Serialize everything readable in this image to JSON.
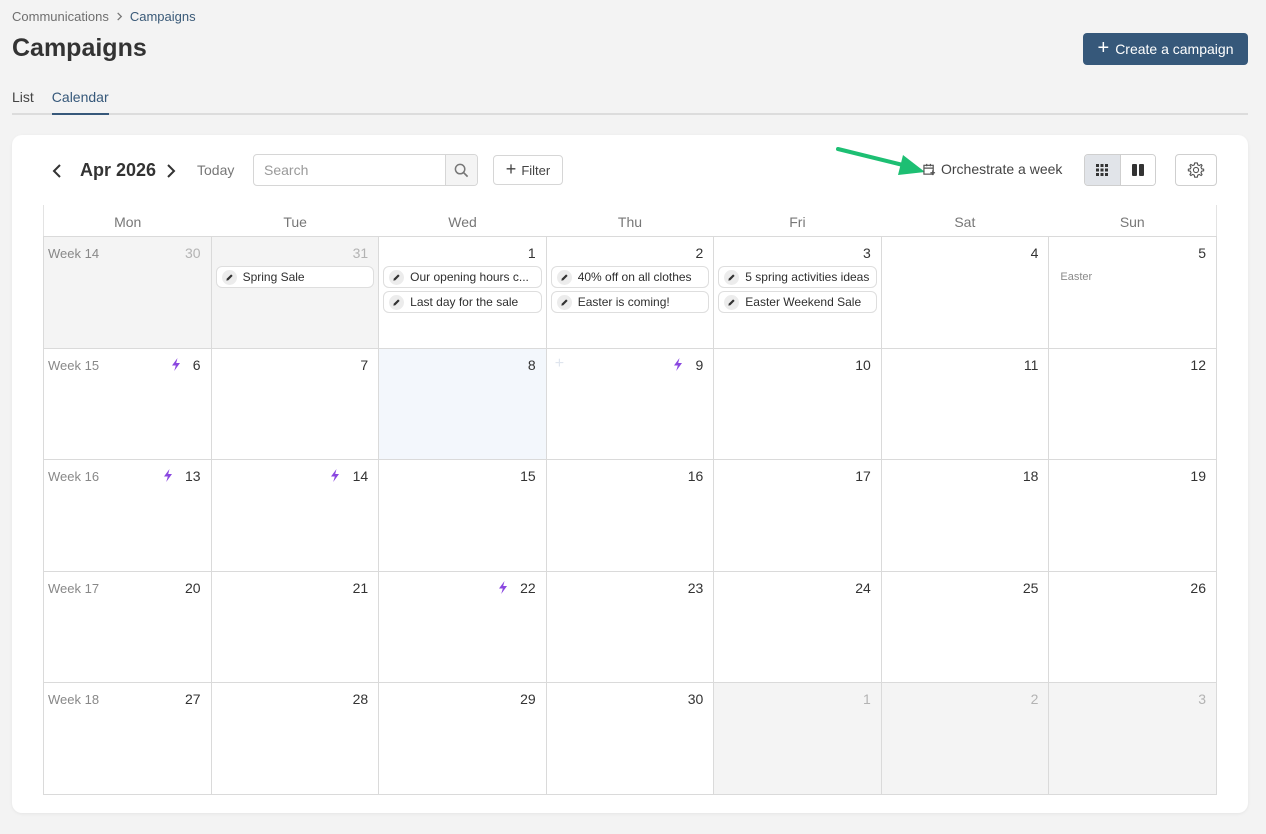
{
  "breadcrumb": {
    "parent": "Communications",
    "current": "Campaigns"
  },
  "page": {
    "title": "Campaigns",
    "create_label": "Create a campaign"
  },
  "tabs": [
    {
      "label": "List"
    },
    {
      "label": "Calendar"
    }
  ],
  "toolbar": {
    "month": "Apr 2026",
    "today_label": "Today",
    "search_placeholder": "Search",
    "filter_label": "Filter",
    "orchestrate_label": "Orchestrate a week"
  },
  "colors": {
    "accent": "#36587a",
    "bolt": "#8a47e0",
    "annotation_arrow": "#1dbf73"
  },
  "calendar": {
    "weekdays": [
      "Mon",
      "Tue",
      "Wed",
      "Thu",
      "Fri",
      "Sat",
      "Sun"
    ],
    "weeks": [
      {
        "label": "Week 14",
        "days": [
          {
            "day": "30",
            "muted": true
          },
          {
            "day": "31",
            "muted": true,
            "events": [
              "Spring Sale"
            ]
          },
          {
            "day": "1",
            "events": [
              "Our opening hours c...",
              "Last day for the sale"
            ]
          },
          {
            "day": "2",
            "events": [
              "40% off on all clothes",
              "Easter is coming!"
            ]
          },
          {
            "day": "3",
            "events": [
              "5 spring activities ideas",
              "Easter Weekend Sale"
            ]
          },
          {
            "day": "4"
          },
          {
            "day": "5",
            "holiday": "Easter"
          }
        ]
      },
      {
        "label": "Week 15",
        "days": [
          {
            "day": "6",
            "bolt": true
          },
          {
            "day": "7"
          },
          {
            "day": "8",
            "today": true
          },
          {
            "day": "9",
            "bolt": true,
            "hover_plus": true
          },
          {
            "day": "10"
          },
          {
            "day": "11"
          },
          {
            "day": "12"
          }
        ]
      },
      {
        "label": "Week 16",
        "days": [
          {
            "day": "13",
            "bolt": true
          },
          {
            "day": "14",
            "bolt": true
          },
          {
            "day": "15"
          },
          {
            "day": "16"
          },
          {
            "day": "17"
          },
          {
            "day": "18"
          },
          {
            "day": "19"
          }
        ]
      },
      {
        "label": "Week 17",
        "days": [
          {
            "day": "20"
          },
          {
            "day": "21"
          },
          {
            "day": "22",
            "bolt": true
          },
          {
            "day": "23"
          },
          {
            "day": "24"
          },
          {
            "day": "25"
          },
          {
            "day": "26"
          }
        ]
      },
      {
        "label": "Week 18",
        "days": [
          {
            "day": "27"
          },
          {
            "day": "28"
          },
          {
            "day": "29"
          },
          {
            "day": "30"
          },
          {
            "day": "1",
            "muted": true
          },
          {
            "day": "2",
            "muted": true
          },
          {
            "day": "3",
            "muted": true
          }
        ]
      }
    ]
  }
}
